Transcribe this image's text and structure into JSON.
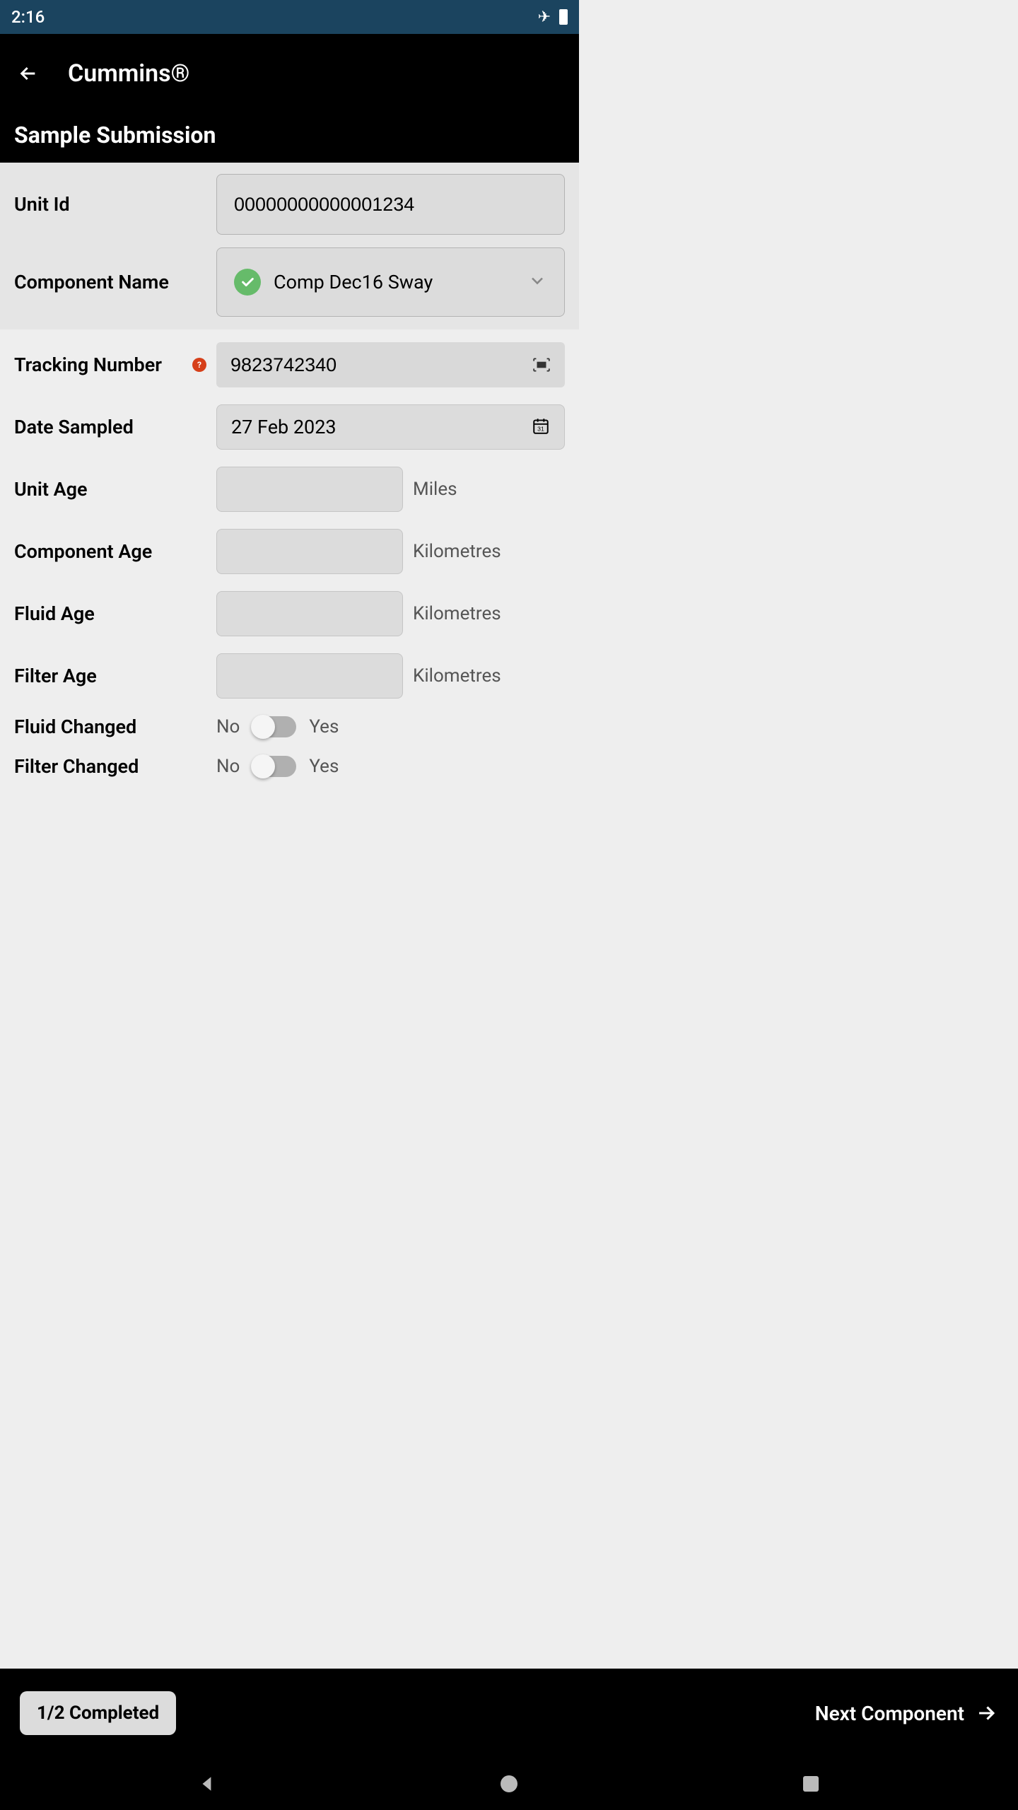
{
  "status": {
    "time": "2:16"
  },
  "header": {
    "title": "Cummins®"
  },
  "section": {
    "title": "Sample Submission"
  },
  "form": {
    "unit_id": {
      "label": "Unit Id",
      "value": "00000000000001234"
    },
    "component_name": {
      "label": "Component Name",
      "value": "Comp Dec16 Sway"
    },
    "tracking_number": {
      "label": "Tracking Number",
      "value": "9823742340"
    },
    "date_sampled": {
      "label": "Date Sampled",
      "value": "27 Feb 2023"
    },
    "unit_age": {
      "label": "Unit Age",
      "value": "",
      "unit": "Miles"
    },
    "component_age": {
      "label": "Component Age",
      "value": "",
      "unit": "Kilometres"
    },
    "fluid_age": {
      "label": "Fluid Age",
      "value": "",
      "unit": "Kilometres"
    },
    "filter_age": {
      "label": "Filter Age",
      "value": "",
      "unit": "Kilometres"
    },
    "fluid_changed": {
      "label": "Fluid Changed",
      "no": "No",
      "yes": "Yes"
    },
    "filter_changed": {
      "label": "Filter Changed",
      "no": "No",
      "yes": "Yes"
    }
  },
  "footer": {
    "progress": "1/2 Completed",
    "next": "Next Component"
  }
}
